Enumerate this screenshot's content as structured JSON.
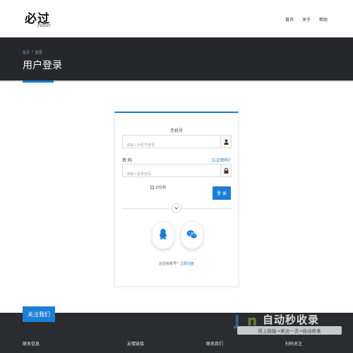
{
  "header": {
    "logo_text": "必过",
    "logo_subtext": "Potter",
    "nav": [
      "首页",
      "关于",
      "帮助"
    ]
  },
  "banner": {
    "breadcrumb_home": "首页",
    "breadcrumb_sep": "/",
    "breadcrumb_current": "登录",
    "title": "用户登录"
  },
  "login": {
    "phone_label": "手机号",
    "phone_placeholder": "请输入手机号登录",
    "password_label": "密 码",
    "forgot_label": "忘记密码?",
    "password_placeholder": "请输入登录密码",
    "remember_label": "记住我",
    "login_button": "登 录",
    "register_prompt": "还没有账号?",
    "register_link": "立即注册"
  },
  "footer": {
    "follow_tab": "关注我们",
    "columns": [
      "联系信息",
      "友情链接",
      "联系我们",
      "扫码关注"
    ]
  },
  "watermark": {
    "brand_j": "J",
    "brand_n": "n",
    "title": "自动秒收录",
    "slogan": "投上链接→来访一次→自动收录"
  },
  "colors": {
    "accent": "#1c7ed6",
    "banner_bg": "#25272b",
    "footer_bg": "#2a2c30"
  }
}
